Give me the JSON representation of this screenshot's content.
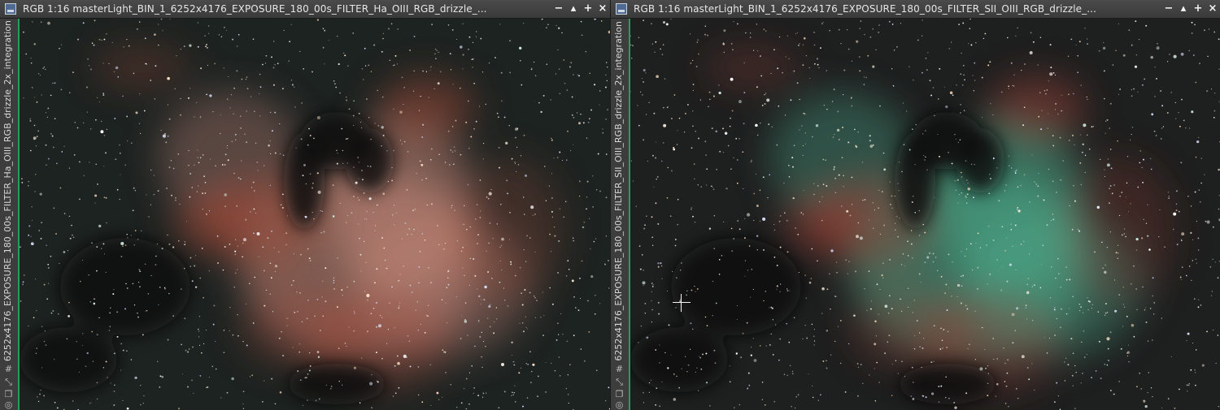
{
  "windows": [
    {
      "title": "RGB 1:16 masterLight_BIN_1_6252x4176_EXPOSURE_180_00s_FILTER_Ha_OIII_RGB_drizzle_...",
      "side_label": "6252x4176_EXPOSURE_180_00s_FILTER_Ha_OIII_RGB_drizzle_2x_integration",
      "buttons": {
        "minimize": "−",
        "shade": "▴",
        "maximize": "+",
        "close": "×"
      },
      "icons": [
        "grid-icon",
        "shrink-icon",
        "copy-icon",
        "pin-icon"
      ]
    },
    {
      "title": "RGB 1:16 masterLight_BIN_1_6252x4176_EXPOSURE_180_00s_FILTER_SII_OIII_RGB_drizzle_...",
      "side_label": "6252x4176_EXPOSURE_180_00s_FILTER_SII_OIII_RGB_drizzle_2x_integration",
      "buttons": {
        "minimize": "−",
        "shade": "▴",
        "maximize": "+",
        "close": "×"
      },
      "icons": [
        "grid-icon",
        "shrink-icon",
        "copy-icon",
        "pin-icon"
      ]
    }
  ],
  "colors": {
    "accent": "#21a155",
    "ha_nebula": "#c8897a",
    "ha_rim": "#a24a38",
    "sii_nebula": "#4fae8e",
    "sii_rim": "#9a4035",
    "sky": "#1b1d1c"
  }
}
